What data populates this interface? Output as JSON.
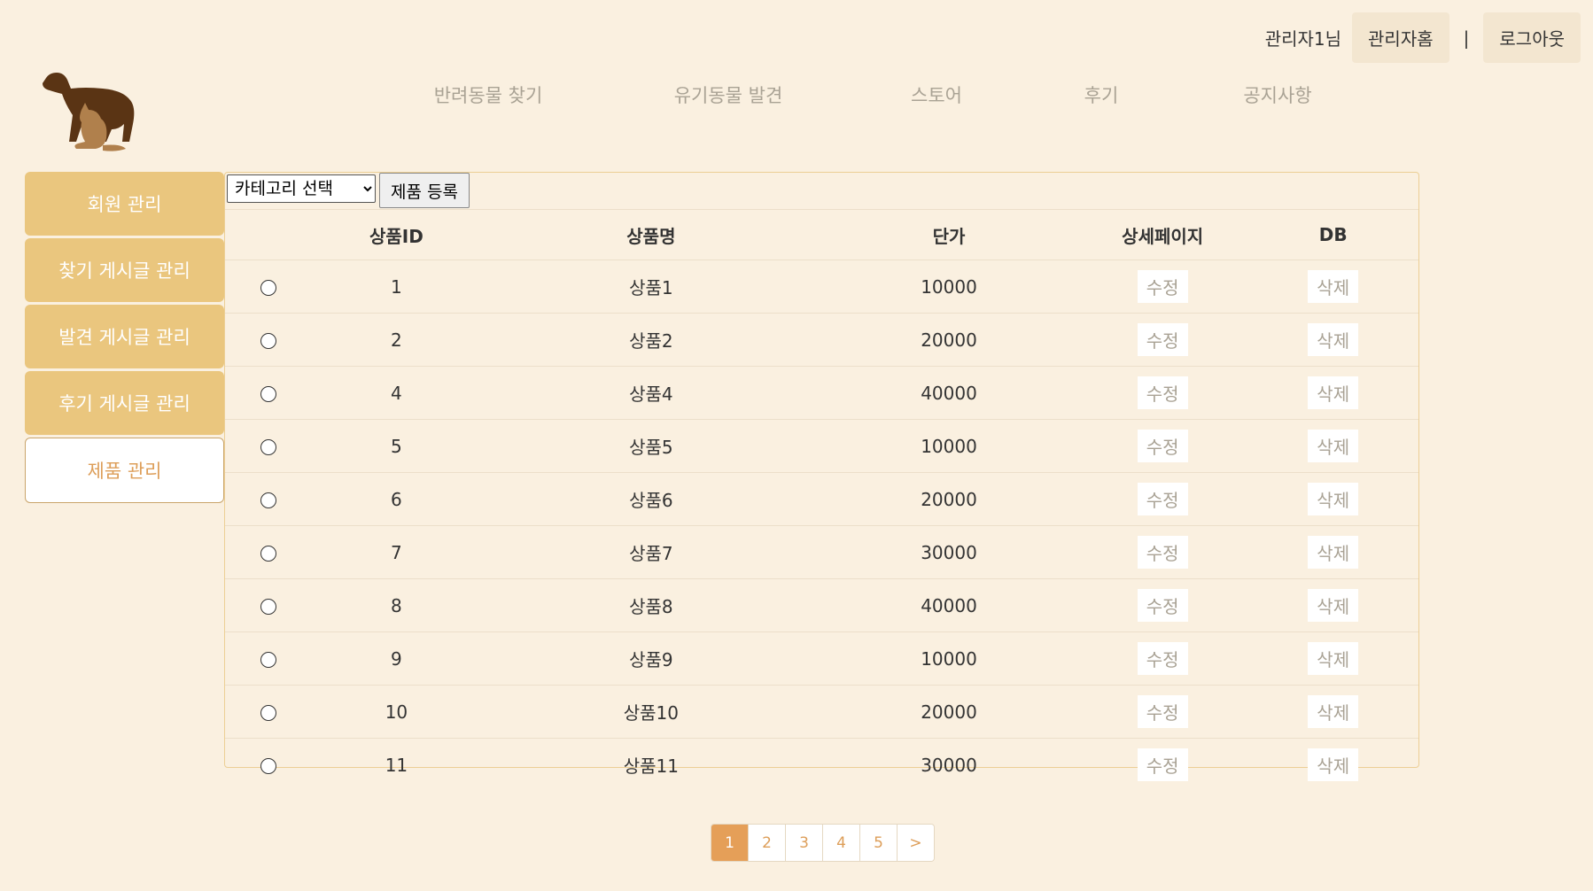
{
  "header": {
    "user_label": "관리자1님",
    "admin_home": "관리자홈",
    "separator": "|",
    "logout": "로그아웃"
  },
  "nav": [
    "반려동물 찾기",
    "유기동물 발견",
    "스토어",
    "후기",
    "공지사항"
  ],
  "sidebar": [
    "회원 관리",
    "찾기 게시글 관리",
    "발견 게시글 관리",
    "후기 게시글 관리",
    "제품 관리"
  ],
  "toolbar": {
    "category_select": "카테고리 선택",
    "register_button": "제품 등록"
  },
  "table": {
    "headers": [
      "",
      "상품ID",
      "상품명",
      "단가",
      "상세페이지",
      "DB"
    ],
    "edit_label": "수정",
    "delete_label": "삭제",
    "rows": [
      {
        "id": "1",
        "name": "상품1",
        "price": "10000"
      },
      {
        "id": "2",
        "name": "상품2",
        "price": "20000"
      },
      {
        "id": "4",
        "name": "상품4",
        "price": "40000"
      },
      {
        "id": "5",
        "name": "상품5",
        "price": "10000"
      },
      {
        "id": "6",
        "name": "상품6",
        "price": "20000"
      },
      {
        "id": "7",
        "name": "상품7",
        "price": "30000"
      },
      {
        "id": "8",
        "name": "상품8",
        "price": "40000"
      },
      {
        "id": "9",
        "name": "상품9",
        "price": "10000"
      },
      {
        "id": "10",
        "name": "상품10",
        "price": "20000"
      },
      {
        "id": "11",
        "name": "상품11",
        "price": "30000"
      }
    ]
  },
  "pagination": [
    "1",
    "2",
    "3",
    "4",
    "5",
    ">"
  ],
  "colors": {
    "background": "#faf0e0",
    "sidebar": "#eac67e",
    "accent": "#e59f58"
  }
}
